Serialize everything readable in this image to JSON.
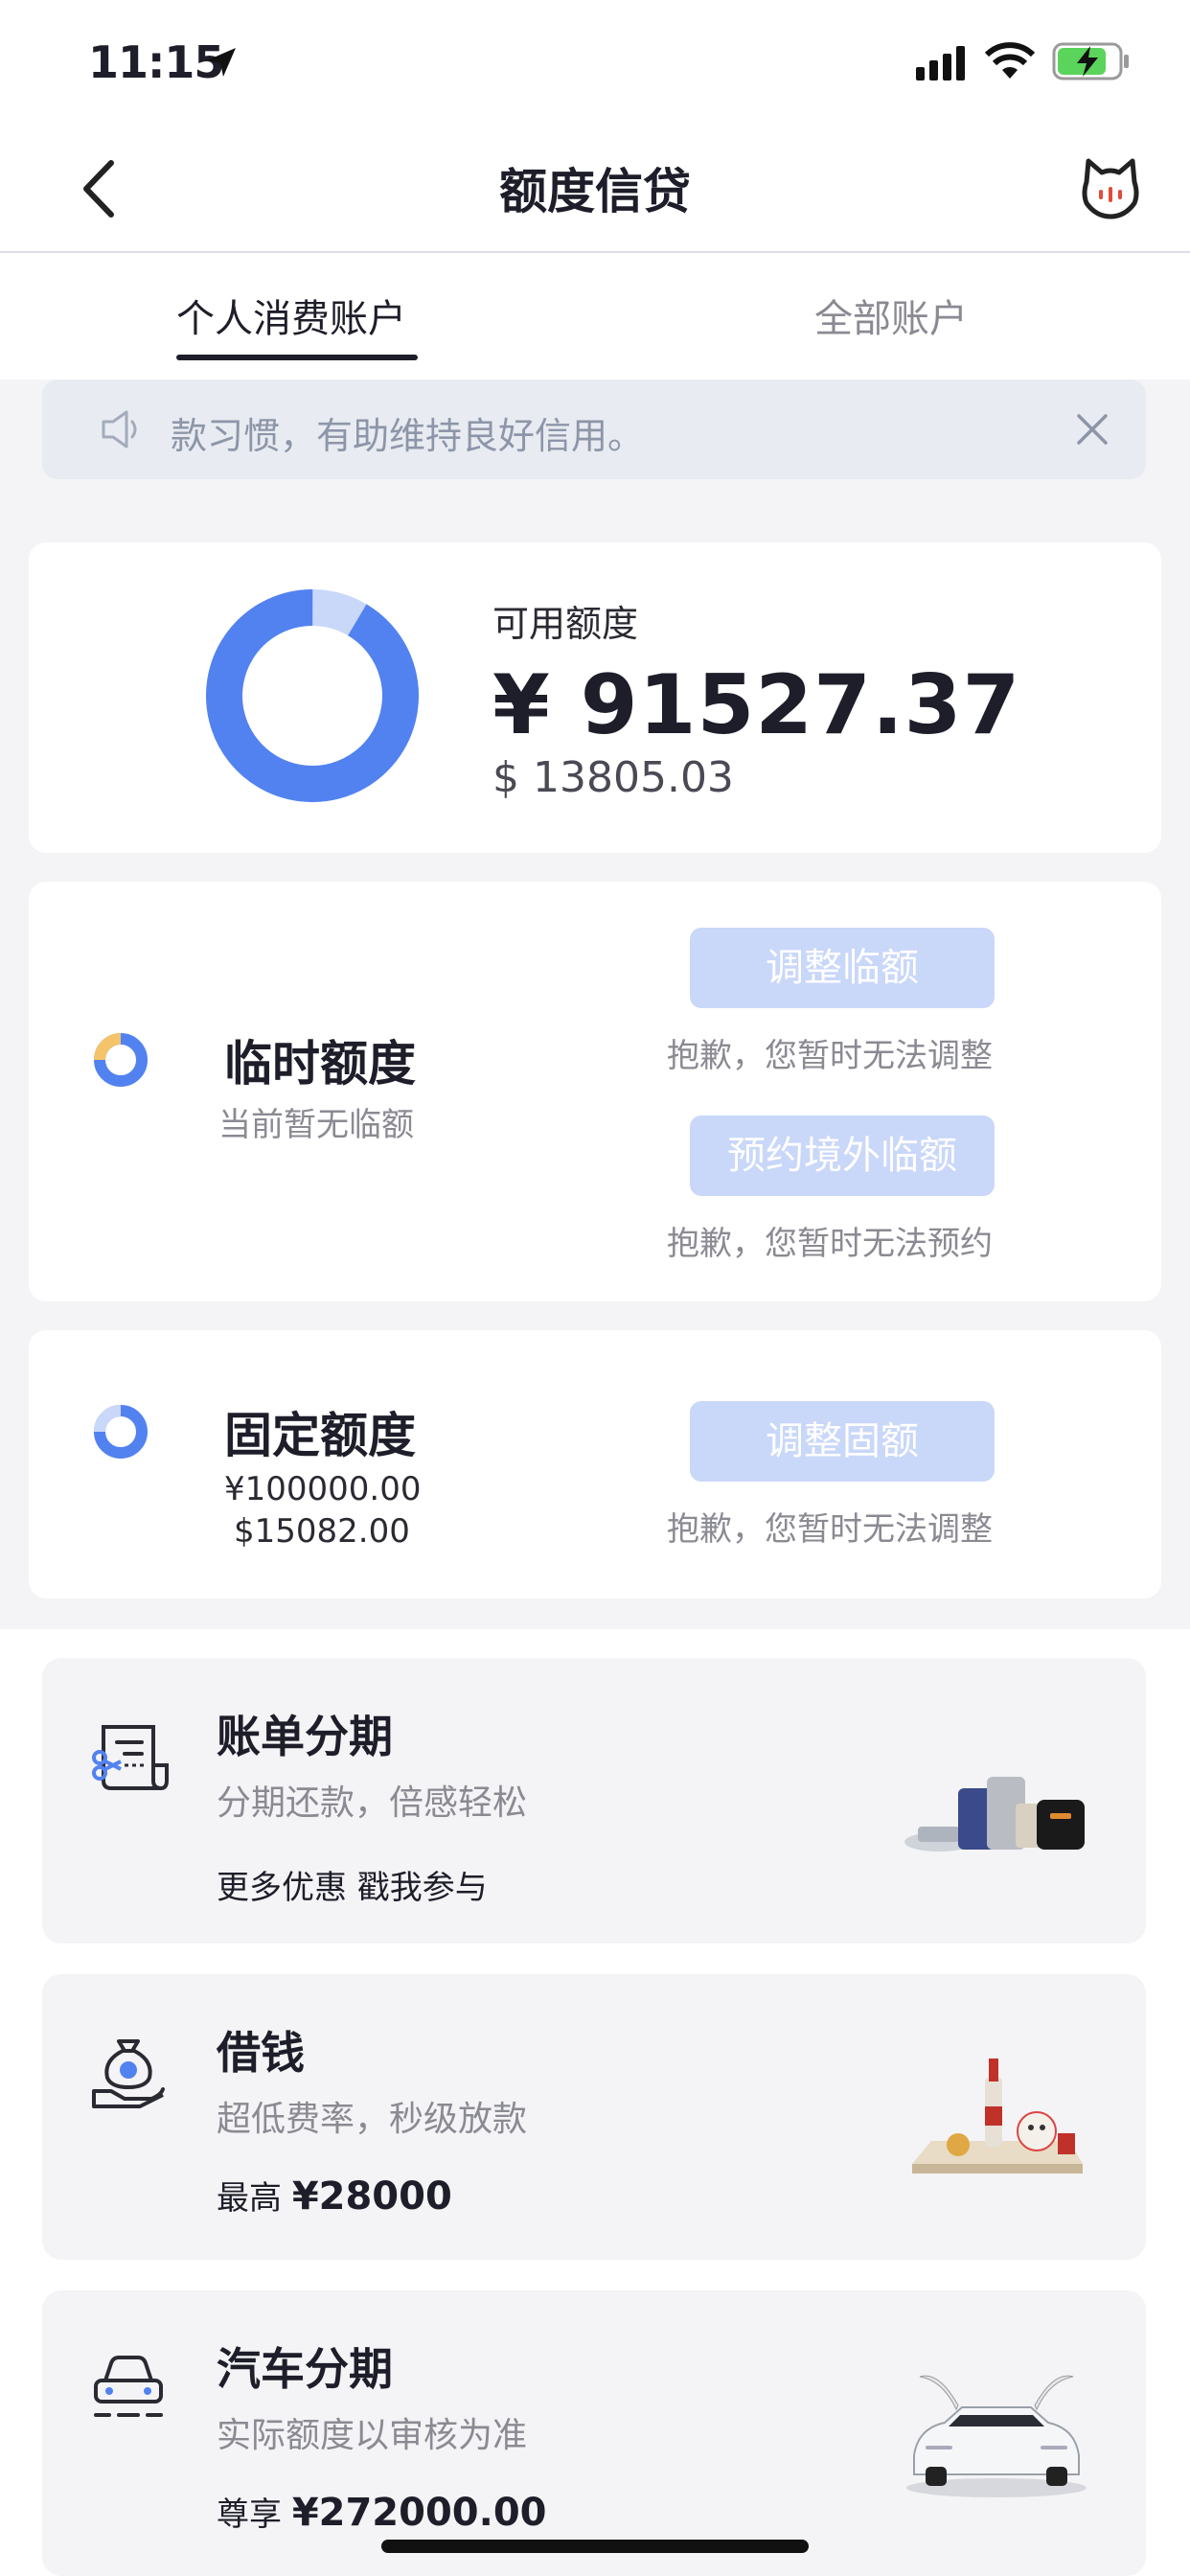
{
  "status_bar": {
    "time": "11:15"
  },
  "nav": {
    "title": "额度信贷"
  },
  "tabs": [
    {
      "label": "个人消费账户",
      "active": true
    },
    {
      "label": "全部账户",
      "active": false
    }
  ],
  "notice": {
    "text": "款习惯，有助维持良好信用。"
  },
  "available": {
    "label": "可用额度",
    "cny": "¥ 91527.37",
    "usd": "$ 13805.03",
    "used_fraction": 0.085
  },
  "temporary": {
    "title": "临时额度",
    "subtitle": "当前暂无临额",
    "adjust_button": "调整临额",
    "adjust_hint": "抱歉，您暂时无法调整",
    "reserve_button": "预约境外临额",
    "reserve_hint": "抱歉，您暂时无法预约"
  },
  "fixed": {
    "title": "固定额度",
    "cny": "¥100000.00",
    "usd": "$15082.00",
    "adjust_button": "调整固额",
    "adjust_hint": "抱歉，您暂时无法调整"
  },
  "promos": [
    {
      "icon": "bill-installment-icon",
      "title": "账单分期",
      "subtitle": "分期还款，倍感轻松",
      "extra_prefix": "更多优惠 戳我参与",
      "extra_amount": ""
    },
    {
      "icon": "money-bag-icon",
      "title": "借钱",
      "subtitle": "超低费率，秒级放款",
      "extra_prefix": "最高",
      "extra_amount": "¥28000"
    },
    {
      "icon": "car-icon",
      "title": "汽车分期",
      "subtitle": "实际额度以审核为准",
      "extra_prefix": "尊享",
      "extra_amount": "¥272000.00"
    }
  ],
  "colors": {
    "accent": "#5282f0",
    "accent_light": "#c9d7f9",
    "temp_ring": "#f5c46a"
  }
}
